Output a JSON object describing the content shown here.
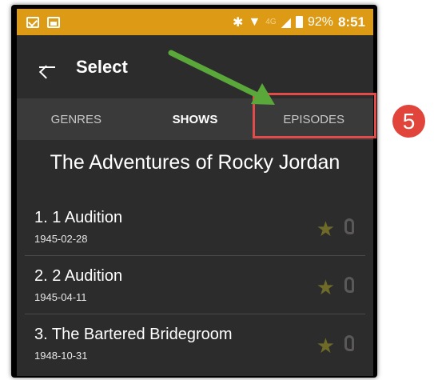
{
  "statusbar": {
    "network": "4G",
    "battery": "92%",
    "time": "8:51",
    "bluetooth_icon": "bluetooth-icon",
    "wifi_icon": "wifi-icon",
    "color": "#dd9a14"
  },
  "appbar": {
    "title": "Select"
  },
  "tabs": [
    {
      "label": "GENRES"
    },
    {
      "label": "SHOWS"
    },
    {
      "label": "EPISODES"
    }
  ],
  "show_title": "The Adventures of Rocky Jordan",
  "episodes": [
    {
      "title": "1. 1 Audition",
      "date": "1945-02-28"
    },
    {
      "title": "2. 2 Audition",
      "date": "1945-04-11"
    },
    {
      "title": "3. The Bartered Bridegroom",
      "date": "1948-10-31"
    }
  ],
  "annotation": {
    "step_number": "5",
    "highlight_color": "#e34a4a",
    "arrow_color": "#5aa83a"
  }
}
